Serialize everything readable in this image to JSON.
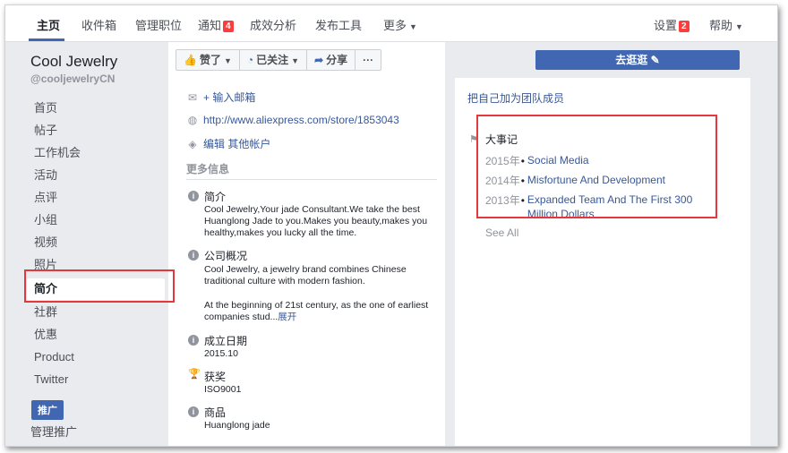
{
  "topnav": {
    "items": [
      "主页",
      "收件箱",
      "管理职位",
      "通知",
      "成效分析",
      "发布工具",
      "更多"
    ],
    "notification_badge": "4",
    "settings": "设置",
    "settings_badge": "2",
    "help": "帮助"
  },
  "sidebar": {
    "page_name": "Cool Jewelry",
    "page_handle": "@cooljewelryCN",
    "items": [
      "首页",
      "帖子",
      "工作机会",
      "活动",
      "点评",
      "小组",
      "视频",
      "照片",
      "简介",
      "社群",
      "优惠",
      "Product",
      "Twitter"
    ],
    "active_item": "简介",
    "promote_button": "推广",
    "manage_promotions": "管理推广"
  },
  "actions": {
    "like": "赞了",
    "follow": "已关注",
    "share": "分享",
    "more": "···"
  },
  "contact": {
    "add_email": "+ 输入邮箱",
    "website": "http://www.aliexpress.com/store/1853043",
    "edit": "编辑",
    "other_accounts": "其他帐户"
  },
  "more_info": {
    "title": "更多信息",
    "about_label": "简介",
    "about_text": "Cool Jewelry,Your jade Consultant.We take the best Huanglong Jade to you.Makes you beauty,makes you healthy,makes you lucky all the time.",
    "company_label": "公司概况",
    "company_text1": "Cool Jewelry, a jewelry brand combines Chinese traditional culture with modern fashion.",
    "company_text2": "At the beginning of 21st century, as the one of earliest companies stud...",
    "see_more": "展开",
    "founded_label": "成立日期",
    "founded_value": "2015.10",
    "awards_label": "获奖",
    "awards_value": "ISO9001",
    "products_label": "商品",
    "products_value": "Huanglong jade"
  },
  "right": {
    "visit_button": "去逛逛",
    "join_team": "把自己加为团队成员",
    "milestones_title": "大事记",
    "milestones": [
      {
        "year": "2015年",
        "title": "Social Media"
      },
      {
        "year": "2014年",
        "title": "Misfortune And Development"
      },
      {
        "year": "2013年",
        "title": "Expanded Team And The First 300 Million Dollars"
      }
    ],
    "see_all": "See All"
  }
}
